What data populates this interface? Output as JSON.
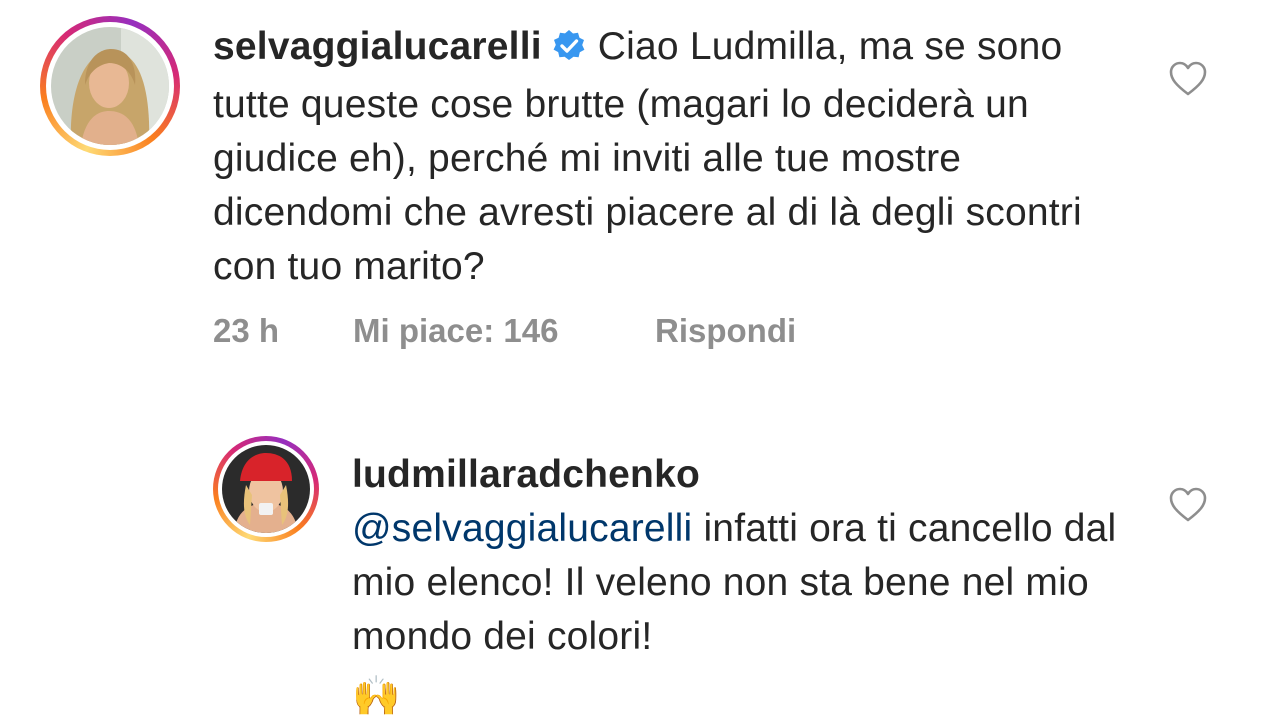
{
  "comments": [
    {
      "username": "selvaggialucarelli",
      "verified": true,
      "text": "Ciao Ludmilla, ma se sono tutte queste cose brutte (magari lo deciderà un giudice eh), perché mi inviti alle tue mostre dicendomi che avresti piacere al di là degli scontri con tuo marito?",
      "time": "23 h",
      "likes": "Mi piace: 146",
      "reply": "Rispondi"
    },
    {
      "username": "ludmillaradchenko",
      "mention": "@selvaggialucarelli",
      "text": "infatti ora ti cancello dal mio elenco! Il veleno non sta bene nel mio mondo dei colori!",
      "emoji": "🙌"
    }
  ],
  "colors": {
    "text": "#262626",
    "meta": "#8e8e8e",
    "mention": "#00376b",
    "verified": "#3897f0"
  },
  "icons": {
    "like": "heart-outline-icon",
    "verified": "verified-badge-icon"
  }
}
